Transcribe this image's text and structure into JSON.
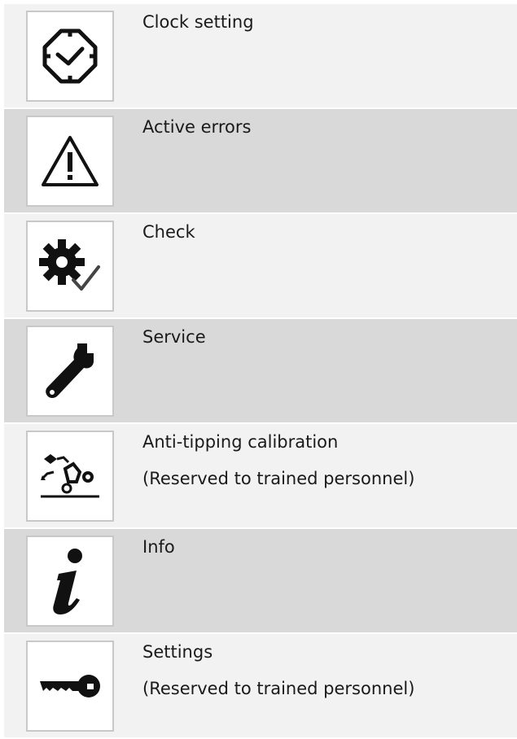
{
  "rows": [
    {
      "label": "Clock setting",
      "icon": "clock-icon"
    },
    {
      "label": "Active errors",
      "icon": "warning-triangle-icon"
    },
    {
      "label": "Check",
      "icon": "gear-check-icon"
    },
    {
      "label": "Service",
      "icon": "wrench-icon"
    },
    {
      "label": "Anti-tipping calibration",
      "sub": "(Reserved to trained personnel)",
      "icon": "anti-tipping-icon"
    },
    {
      "label": "Info",
      "icon": "info-icon"
    },
    {
      "label": "Settings",
      "sub": "(Reserved to trained personnel)",
      "icon": "key-icon"
    }
  ],
  "colors": {
    "row_light": "#f2f2f2",
    "row_dark": "#d9d9d9",
    "icon_border": "#c8c8c8",
    "ink": "#1a1a1a"
  }
}
